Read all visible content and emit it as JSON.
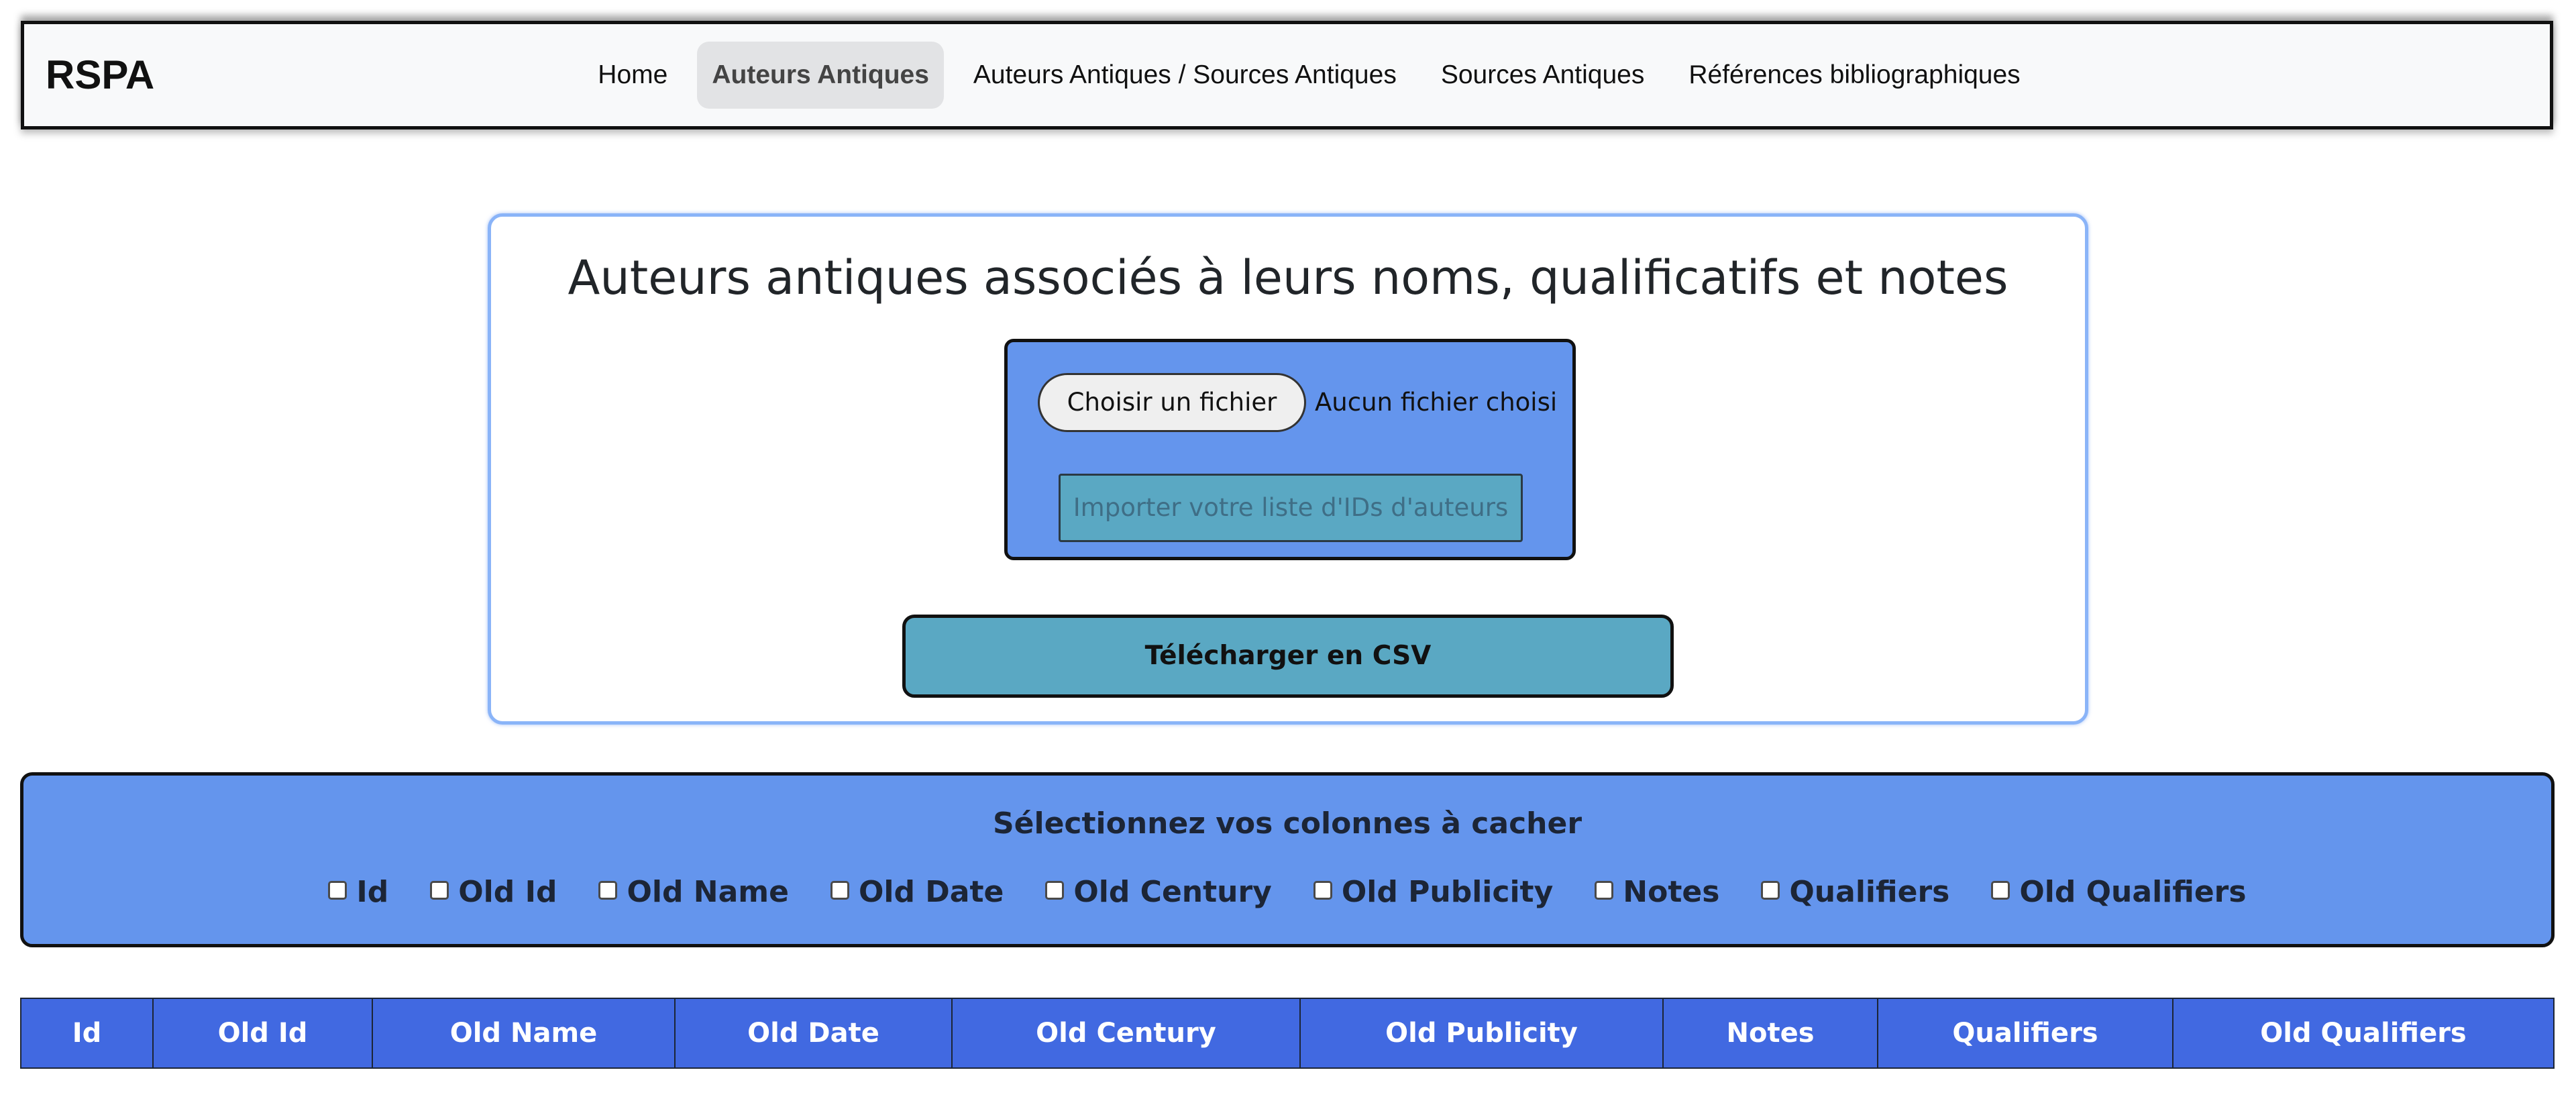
{
  "navbar": {
    "brand": "RSPA",
    "items": [
      {
        "label": "Home",
        "active": false
      },
      {
        "label": "Auteurs Antiques",
        "active": true
      },
      {
        "label": "Auteurs Antiques / Sources Antiques",
        "active": false
      },
      {
        "label": "Sources Antiques",
        "active": false
      },
      {
        "label": "Références bibliographiques",
        "active": false
      }
    ]
  },
  "import_card": {
    "title": "Auteurs antiques associés à leurs noms, qualificatifs et notes",
    "file_button": "Choisir un fichier",
    "file_status": "Aucun fichier choisi",
    "import_placeholder": "Importer votre liste d'IDs d'auteurs",
    "csv_button": "Télécharger en CSV"
  },
  "column_selector": {
    "title": "Sélectionnez vos colonnes à cacher",
    "options": [
      {
        "label": "Id",
        "checked": false
      },
      {
        "label": "Old Id",
        "checked": false
      },
      {
        "label": "Old Name",
        "checked": false
      },
      {
        "label": "Old Date",
        "checked": false
      },
      {
        "label": "Old Century",
        "checked": false
      },
      {
        "label": "Old Publicity",
        "checked": false
      },
      {
        "label": "Notes",
        "checked": false
      },
      {
        "label": "Qualifiers",
        "checked": false
      },
      {
        "label": "Old Qualifiers",
        "checked": false
      }
    ]
  },
  "table": {
    "headers": [
      "Id",
      "Old Id",
      "Old Name",
      "Old Date",
      "Old Century",
      "Old Publicity",
      "Notes",
      "Qualifiers",
      "Old Qualifiers"
    ]
  },
  "colors": {
    "navbar_bg": "#f8f9fa",
    "panel_blue": "#6495ed",
    "table_header_blue": "#4169e1",
    "button_teal": "#5aa8c3",
    "card_border": "#8ab4f8"
  }
}
